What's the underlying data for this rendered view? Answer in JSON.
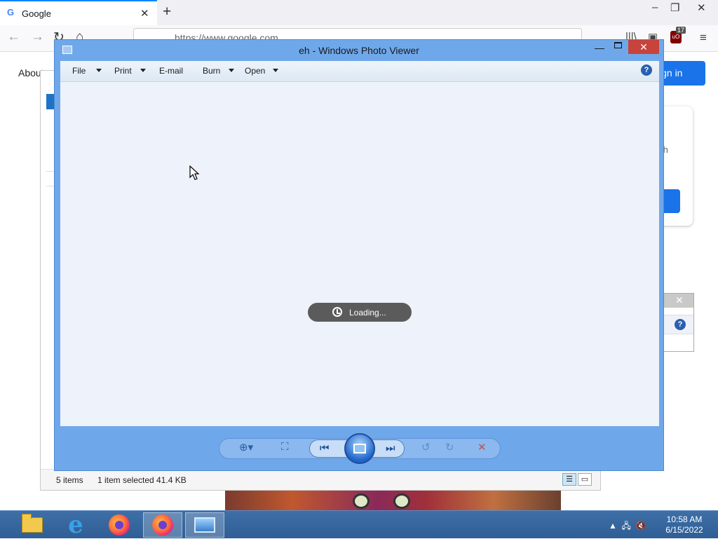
{
  "browser": {
    "tab_title": "Google",
    "tab_favicon": "G",
    "url_display": "https://www.google.com",
    "ublock_count": "17",
    "about_link": "About",
    "signin_label": "ign in",
    "card_text_fragment": "th"
  },
  "explorer": {
    "status_items": "5 items",
    "status_selection": "1 item selected  41.4 KB"
  },
  "photo_viewer": {
    "title": "eh - Windows Photo Viewer",
    "menu": [
      {
        "label": "File",
        "has_dropdown": true
      },
      {
        "label": "Print",
        "has_dropdown": true
      },
      {
        "label": "E-mail",
        "has_dropdown": false
      },
      {
        "label": "Burn",
        "has_dropdown": true
      },
      {
        "label": "Open",
        "has_dropdown": true
      }
    ],
    "loading_text": "Loading...",
    "controls": [
      "zoom-icon",
      "fit-window-icon",
      "previous-icon",
      "slideshow-icon",
      "next-icon",
      "rotate-ccw-icon",
      "rotate-cw-icon",
      "delete-icon"
    ]
  },
  "taskbar": {
    "apps": [
      "file-explorer-icon",
      "internet-explorer-icon",
      "firefox-icon",
      "firefox-icon",
      "photo-viewer-icon"
    ],
    "time": "10:58 AM",
    "date": "6/15/2022"
  },
  "colors": {
    "photo_viewer_frame": "#6fa8ea",
    "close_button": "#c7433c",
    "taskbar": "#2f5e96",
    "google_blue": "#1a73e8"
  }
}
